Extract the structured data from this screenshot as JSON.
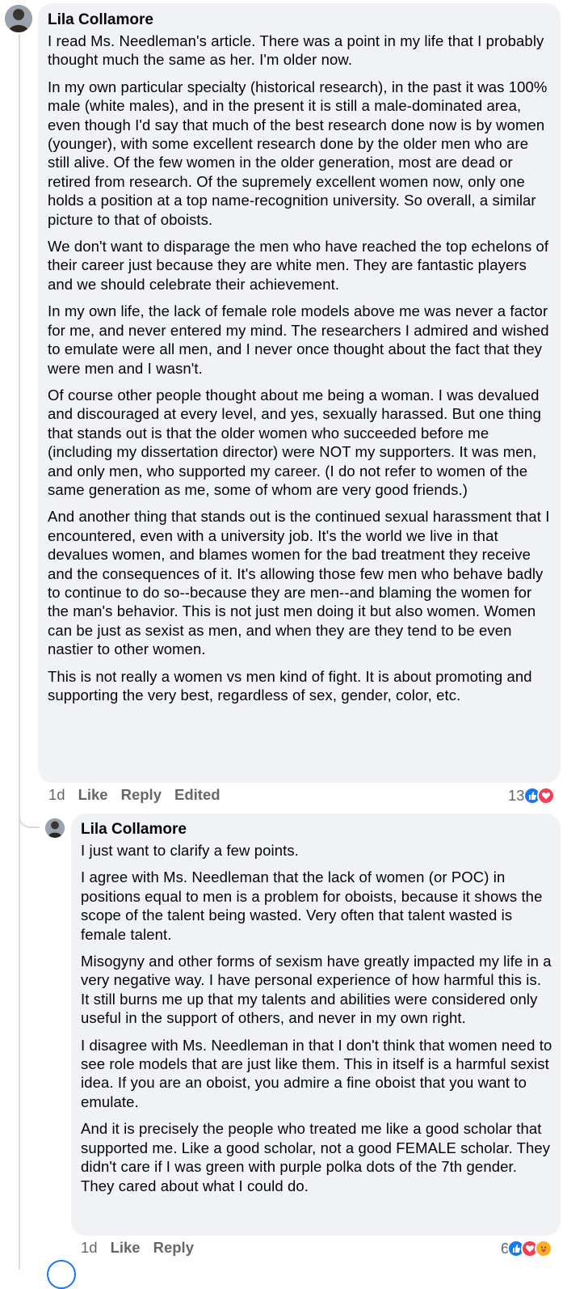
{
  "comments": [
    {
      "author": "Lila Collamore",
      "paragraphs": [
        "I read Ms. Needleman's article. There was a point in my life that I probably thought much the same as her. I'm older now.",
        "In my own particular specialty (historical research), in the past it was 100% male (white males), and in the present it is still a male-dominated area, even though I'd say that much of the best research done now is by women (younger), with some excellent research done by the older men who are still alive. Of the few women in the older generation, most are dead or retired from research. Of the supremely excellent women now, only one holds a position at a top name-recognition university. So overall, a similar picture to that of oboists.",
        "We don't want to disparage the men who have reached the top echelons of their career just because they are white men. They are fantastic players and we should celebrate their achievement.",
        "In my own life, the lack of female role models above me was never a factor for me, and never entered my mind. The researchers I admired and wished to emulate were all men, and I never once thought about the fact that they were men and I wasn't.",
        "Of course other people thought about me being a woman. I was devalued and discouraged at every level, and yes, sexually harassed. But one thing that stands out is that the older women who succeeded before me (including my dissertation director) were NOT my supporters. It was men, and only men, who supported my career. (I do not refer to women of the same generation as me, some of whom are very good friends.)",
        "And another thing that stands out is the continued sexual harassment that I encountered, even with a university job. It's the world we live in that devalues women, and blames women for the bad treatment they receive and the consequences of it. It's allowing those few men who behave badly to continue to do so--because they are men--and blaming the women for the man's behavior. This is not just men doing it but also women. Women can be just as sexist as men, and when they are they tend to be even nastier to other women.",
        "This is not really a women vs men kind of fight. It is about promoting and supporting the very best, regardless of sex, gender, color, etc."
      ],
      "time": "1d",
      "like_label": "Like",
      "reply_label": "Reply",
      "edited_label": "Edited",
      "reaction_count": "13",
      "reaction_icons": [
        "like-icon",
        "love-icon"
      ]
    },
    {
      "author": "Lila Collamore",
      "paragraphs": [
        "I just want to clarify a few points.",
        "I agree with Ms. Needleman that the lack of women (or POC) in positions equal to men is a problem for oboists, because it shows the scope of the talent being wasted. Very often that talent wasted is female talent.",
        "Misogyny and other forms of sexism have greatly impacted my life in a very negative way. I have personal experience of how harmful this is. It still burns me up that my talents and abilities were considered only useful in the support of others, and never in my own right.",
        "I disagree with Ms. Needleman in that I don't think that women need to see role models that are just like them. This in itself is a harmful sexist idea. If you are an oboist, you admire a fine oboist that you want to emulate.",
        "And it is precisely the people who treated me like a good scholar that supported me. Like a good scholar, not a good FEMALE scholar. They didn't care if I was green with purple polka dots of the 7th gender. They cared about what I could do."
      ],
      "time": "1d",
      "like_label": "Like",
      "reply_label": "Reply",
      "reaction_count": "6",
      "reaction_icons": [
        "like-icon",
        "love-icon",
        "care-icon"
      ]
    }
  ],
  "colors": {
    "bubble_bg": "#f0f2f5",
    "meta_text": "#65676b",
    "like_blue": "#1877f2",
    "love_red": "#f33e58",
    "care_yellow": "#f7b125"
  }
}
